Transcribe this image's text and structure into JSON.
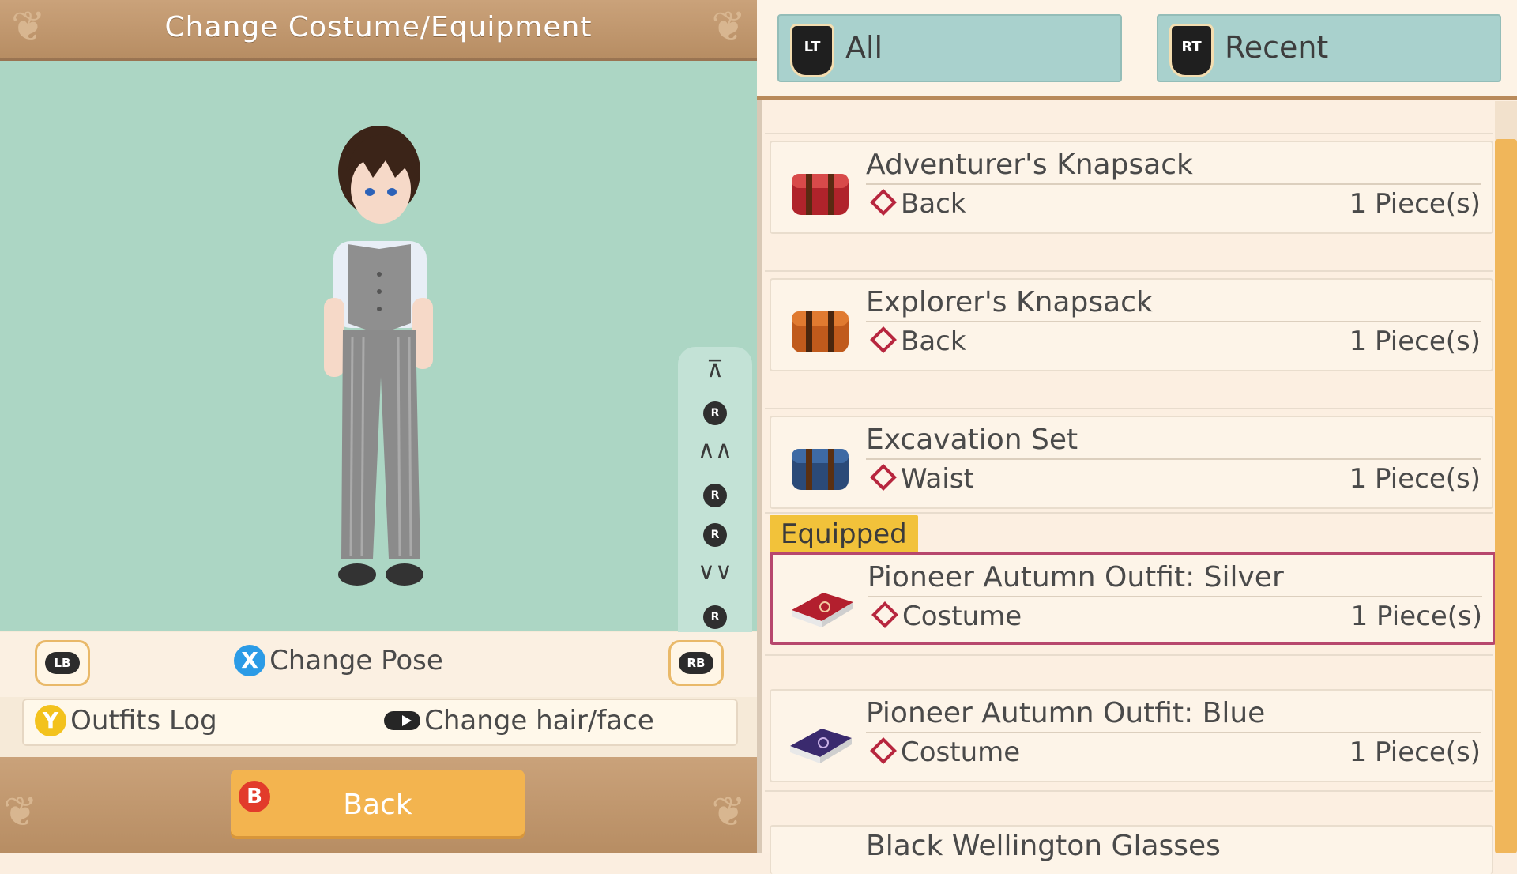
{
  "header": {
    "title": "Change Costume/Equipment"
  },
  "camera_controls": {
    "top": "⊼",
    "up": "∧∧",
    "down": "∨∨",
    "bottom": "⊻",
    "r_label": "R"
  },
  "pose": {
    "lb": "LB",
    "rb": "RB",
    "x_glyph": "X",
    "label": "Change Pose"
  },
  "outfits": {
    "y_glyph": "Y",
    "log_label": "Outfits Log",
    "hair_label": "Change hair/face"
  },
  "footer": {
    "b_glyph": "B",
    "back_label": "Back"
  },
  "tabs": [
    {
      "tag": "LT",
      "label": "All"
    },
    {
      "tag": "RT",
      "label": "Recent"
    }
  ],
  "equipped_label": "Equipped",
  "items": [
    {
      "name": "Adventurer's Knapsack",
      "slot": "Back",
      "count": "1 Piece(s)",
      "color": "#b0232b"
    },
    {
      "name": "Explorer's Knapsack",
      "slot": "Back",
      "count": "1 Piece(s)",
      "color": "#c05a1c"
    },
    {
      "name": "Excavation Set",
      "slot": "Waist",
      "count": "1 Piece(s)",
      "color": "#2b4a78"
    },
    {
      "name": "Pioneer Autumn Outfit: Silver",
      "slot": "Costume",
      "count": "1 Piece(s)",
      "color": "#b31f2e"
    },
    {
      "name": "Pioneer Autumn Outfit: Blue",
      "slot": "Costume",
      "count": "1 Piece(s)",
      "color": "#3a2a6e"
    },
    {
      "name": "Black Wellington Glasses"
    }
  ]
}
